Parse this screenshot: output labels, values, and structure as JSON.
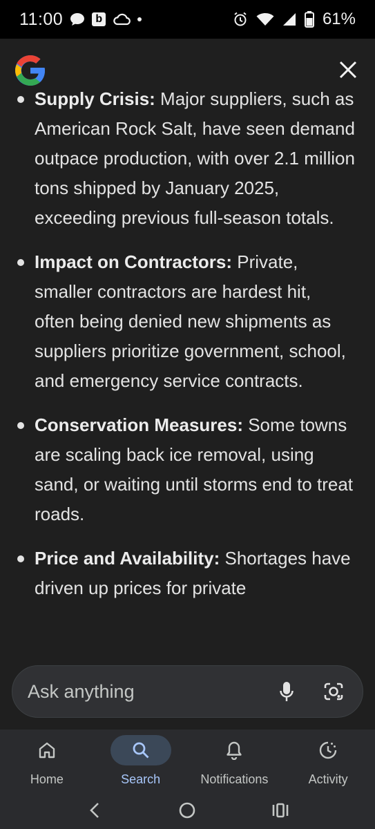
{
  "status_bar": {
    "time": "11:00",
    "battery_percent": "61%",
    "icons": [
      "chat-bubble-icon",
      "b-app-icon",
      "cloud-icon",
      "dot-icon",
      "alarm-icon",
      "wifi-icon",
      "signal-icon",
      "battery-icon"
    ],
    "b_app_letter": "b"
  },
  "header": {
    "logo": "google-g-logo",
    "close_icon": "close-icon"
  },
  "content": {
    "bullets": [
      {
        "title": "Supply Crisis:",
        "text": " Major suppliers, such as American Rock Salt, have seen demand outpace production, with over 2.1 million tons shipped by January 2025, exceeding previous full-season totals."
      },
      {
        "title": "Impact on Contractors:",
        "text": " Private, smaller contractors are hardest hit, often being denied new shipments as suppliers prioritize government, school, and emergency service contracts."
      },
      {
        "title": "Conservation Measures:",
        "text": " Some towns are scaling back ice removal, using sand, or waiting until storms end to treat roads."
      },
      {
        "title": "Price and Availability:",
        "text": " Shortages have driven up prices for private"
      }
    ]
  },
  "ask_bar": {
    "placeholder": "Ask anything",
    "mic_icon": "mic-icon",
    "lens_icon": "lens-icon"
  },
  "bottom_nav": {
    "items": [
      {
        "label": "Home",
        "icon": "home-icon",
        "active": false
      },
      {
        "label": "Search",
        "icon": "search-icon",
        "active": true
      },
      {
        "label": "Notifications",
        "icon": "bell-icon",
        "active": false
      },
      {
        "label": "Activity",
        "icon": "activity-icon",
        "active": false
      }
    ]
  },
  "system_nav": {
    "buttons": [
      "back-icon",
      "home-circle-icon",
      "recents-icon"
    ]
  },
  "colors": {
    "background": "#1f1f1f",
    "status_bar": "#000000",
    "text": "#e3e3e3",
    "ask_bar": "#303134",
    "nav_bar": "#2a2b2e",
    "active_pill": "#3b4858",
    "active_label": "#a8c7fa"
  }
}
